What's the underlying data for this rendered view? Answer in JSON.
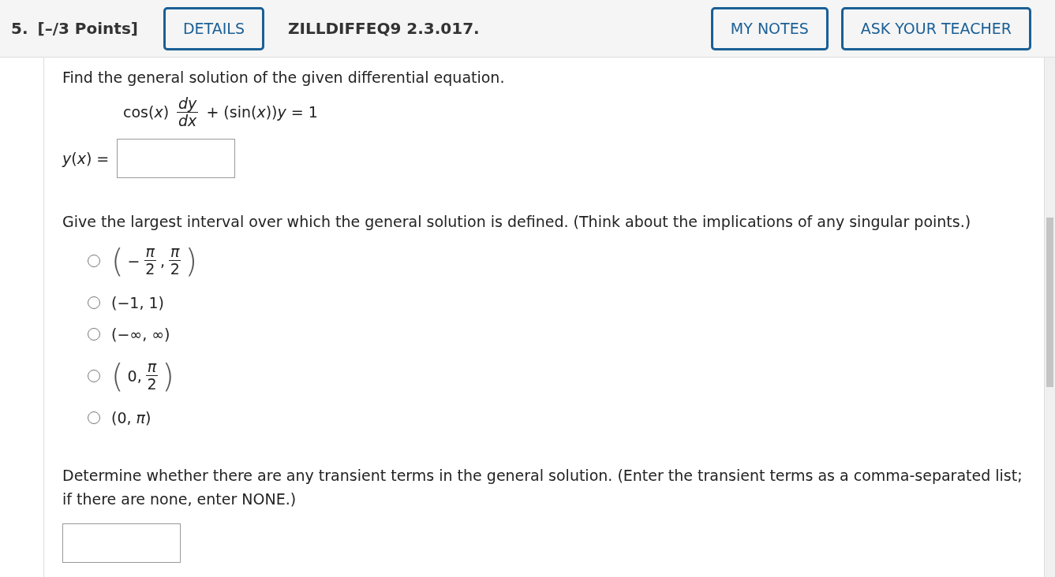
{
  "header": {
    "number": "5.",
    "points": "[–/3 Points]",
    "details_button": "DETAILS",
    "code": "ZILLDIFFEQ9 2.3.017.",
    "buttons": [
      "MY NOTES",
      "ASK YOUR TEACHER"
    ]
  },
  "question": {
    "prompt": "Find the general solution of the given differential equation.",
    "equation": [
      {
        "kind": "text",
        "text": "cos(*x*)"
      },
      {
        "kind": "frac",
        "num": "*dy*",
        "den": "*dx*"
      },
      {
        "kind": "text",
        "text": "+ (sin(*x*))*y* = 1"
      }
    ],
    "answer_label": "*y*(*x*) ="
  },
  "interval": {
    "prompt": "Give the largest interval over which the general solution is defined. (Think about the implications of any singular points.)",
    "options": [
      {
        "selected": false,
        "kind": "math",
        "open": "(",
        "close": ")",
        "items": [
          {
            "kind": "text",
            "text": "−"
          },
          {
            "kind": "frac",
            "num": "*π*",
            "den": "2"
          },
          {
            "kind": "text",
            "text": ","
          },
          {
            "kind": "frac",
            "num": "*π*",
            "den": "2"
          }
        ]
      },
      {
        "selected": false,
        "kind": "plain",
        "text": "(−1, 1)"
      },
      {
        "selected": false,
        "kind": "plain",
        "text": "(−∞, ∞)"
      },
      {
        "selected": false,
        "kind": "math",
        "open": "(",
        "close": ")",
        "items": [
          {
            "kind": "text",
            "text": "0,"
          },
          {
            "kind": "frac",
            "num": "*π*",
            "den": "2"
          }
        ]
      },
      {
        "selected": false,
        "kind": "plain",
        "text": "(0, *π*)"
      }
    ]
  },
  "transient": {
    "prompt": "Determine whether there are any transient terms in the general solution. (Enter the transient terms as a comma-separated list; if there are none, enter NONE.)"
  }
}
